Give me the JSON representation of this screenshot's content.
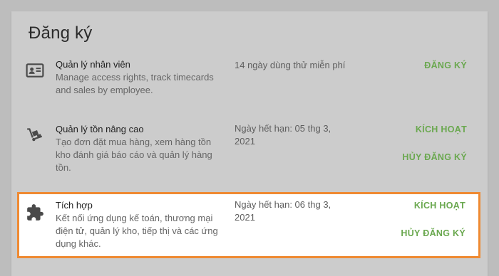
{
  "section_title": "Đăng ký",
  "accent_color": "#6aa84f",
  "highlight_color": "#ef8a32",
  "rows": [
    {
      "icon": "id-card-icon",
      "name": "Quản lý nhân viên",
      "description": "Manage access rights, track timecards and sales by employee.",
      "status": "14 ngày dùng thử miễn phí",
      "actions": [
        "ĐĂNG KÝ"
      ]
    },
    {
      "icon": "hand-truck-icon",
      "name": "Quản lý tồn nâng cao",
      "description": "Tạo đơn đặt mua hàng, xem hàng tồn kho đánh giá báo cáo và quản lý hàng tồn.",
      "status": "Ngày hết hạn: 05 thg 3, 2021",
      "actions": [
        "KÍCH HOẠT",
        "HỦY ĐĂNG KÝ"
      ]
    },
    {
      "icon": "puzzle-piece-icon",
      "name": "Tích hợp",
      "description": "Kết nối ứng dụng kế toán, thương mại điện tử, quản lý kho, tiếp thị và các ứng dụng khác.",
      "status": "Ngày hết hạn: 06 thg 3, 2021",
      "actions": [
        "KÍCH HOẠT",
        "HỦY ĐĂNG KÝ"
      ]
    }
  ]
}
